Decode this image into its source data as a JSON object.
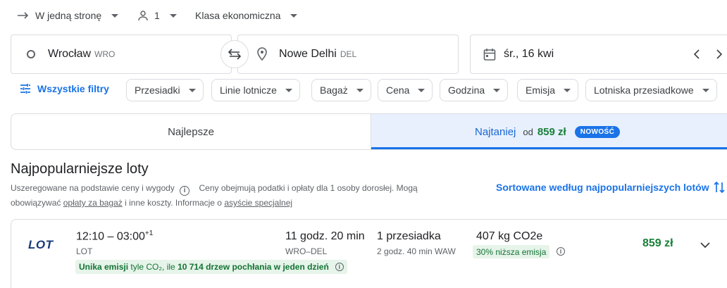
{
  "trip": {
    "type_label": "W jedną stronę",
    "passengers": "1",
    "class_label": "Klasa ekonomiczna"
  },
  "search": {
    "origin": "Wrocław",
    "origin_code": "WRO",
    "destination": "Nowe Delhi",
    "destination_code": "DEL",
    "date": "śr., 16 kwi"
  },
  "filters": {
    "all_label": "Wszystkie filtry",
    "chips": [
      "Przesiadki",
      "Linie lotnicze",
      "Bagaż",
      "Cena",
      "Godzina",
      "Emisja",
      "Lotniska przesiadkowe"
    ]
  },
  "tabs": {
    "best": "Najlepsze",
    "cheapest": "Najtaniej",
    "from_label": "od",
    "cheapest_price": "859 zł",
    "badge": "NOWOŚĆ"
  },
  "section": {
    "title": "Najpopularniejsze loty",
    "ranked_text": "Uszeregowane na podstawie ceny i wygody",
    "info_text_1": "Ceny obejmują podatki i opłaty dla 1 osoby dorosłej. Mogą obowiązywać",
    "bag_fees_link": "opłaty za bagaż",
    "info_text_2": "i inne koszty. Informacje o",
    "special_assistance_link": "asyście specjalnej",
    "sort_label": "Sortowane według najpopularniejszych lotów"
  },
  "flight": {
    "logo": "LOT",
    "depart": "12:10",
    "dash": "–",
    "arrive": "03:00",
    "day_offset": "+1",
    "airline": "LOT",
    "emission_bold_1": "Unika emisji",
    "emission_text_1": "tyle CO₂, ile",
    "emission_bold_2": "10 714 drzew pochłania w jeden dzień",
    "duration": "11 godz. 20 min",
    "route": "WRO–DEL",
    "stops": "1 przesiadka",
    "layover": "2 godz. 40 min WAW",
    "co2": "407 kg CO2e",
    "co2_tag": "30% niższa emisja",
    "price": "859 zł"
  },
  "colors": {
    "accent": "#1a73e8",
    "price_green": "#188038",
    "tab_selected_bg": "#e8f0fe",
    "eco_bg": "#e6f4ea"
  }
}
